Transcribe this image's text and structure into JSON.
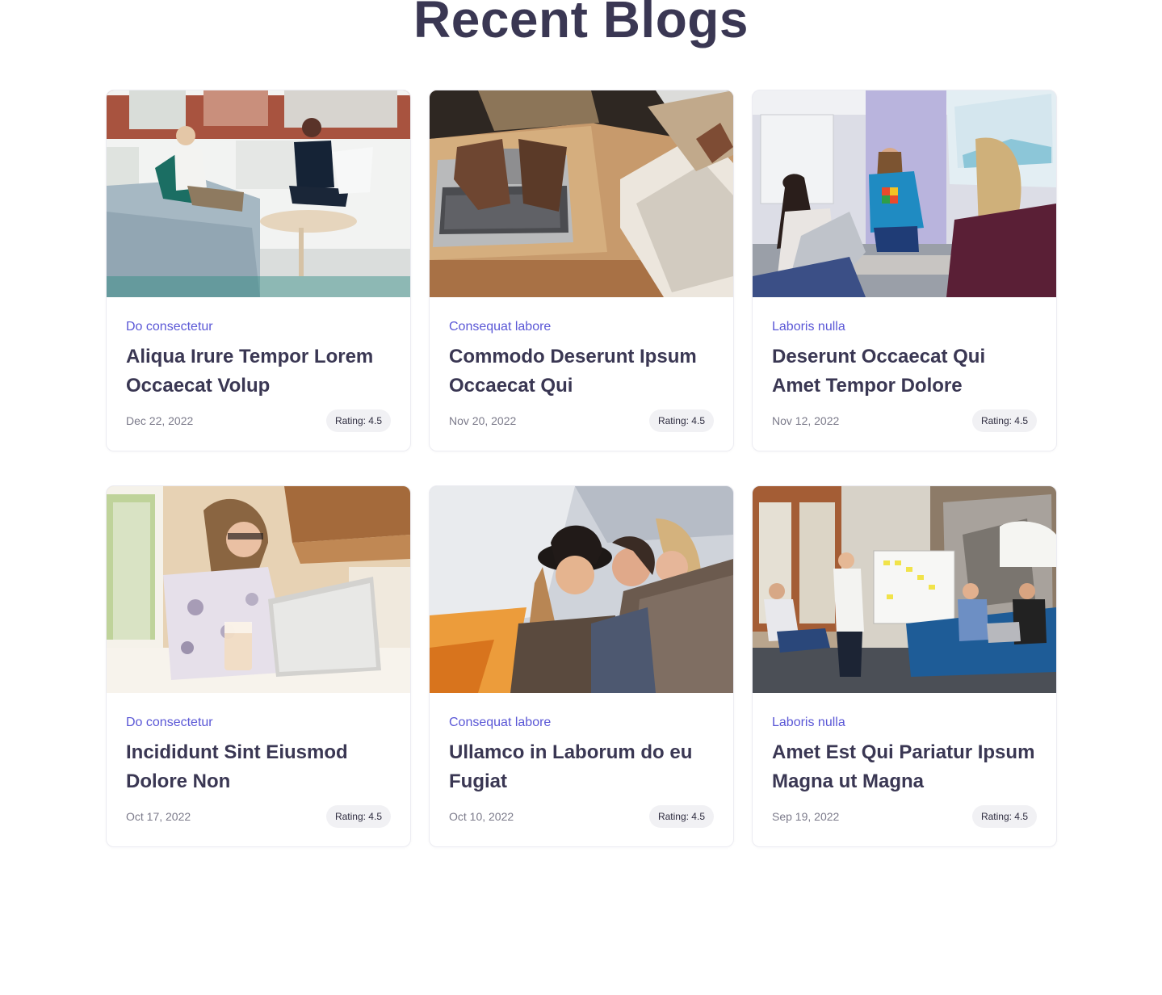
{
  "section": {
    "title": "Recent Blogs"
  },
  "colors": {
    "heading": "#3a3753",
    "category": "#5a57d6",
    "date": "#7b7a8a",
    "badge_bg": "#f1f1f4"
  },
  "posts": [
    {
      "image": "office-meeting-couch-photo",
      "category": "Do consectetur",
      "title": "Aliqua Irure Tempor Lorem Occaecat Volup",
      "date": "Dec 22, 2022",
      "rating_label": "Rating: 4.5"
    },
    {
      "image": "laptops-on-table-photo",
      "category": "Consequat labore",
      "title": "Commodo Deserunt Ipsum Occaecat Qui",
      "date": "Nov 20, 2022",
      "rating_label": "Rating: 4.5"
    },
    {
      "image": "presentation-meeting-photo",
      "category": "Laboris nulla",
      "title": "Deserunt Occaecat Qui Amet Tempor Dolore",
      "date": "Nov 12, 2022",
      "rating_label": "Rating: 4.5"
    },
    {
      "image": "woman-with-laptop-photo",
      "category": "Do consectetur",
      "title": "Incididunt Sint Eiusmod Dolore Non",
      "date": "Oct 17, 2022",
      "rating_label": "Rating: 4.5"
    },
    {
      "image": "friends-laughing-photo",
      "category": "Consequat labore",
      "title": "Ullamco in Laborum do eu Fugiat",
      "date": "Oct 10, 2022",
      "rating_label": "Rating: 4.5"
    },
    {
      "image": "team-whiteboard-meeting-photo",
      "category": "Laboris nulla",
      "title": "Amet Est Qui Pariatur Ipsum Magna ut Magna",
      "date": "Sep 19, 2022",
      "rating_label": "Rating: 4.5"
    }
  ]
}
